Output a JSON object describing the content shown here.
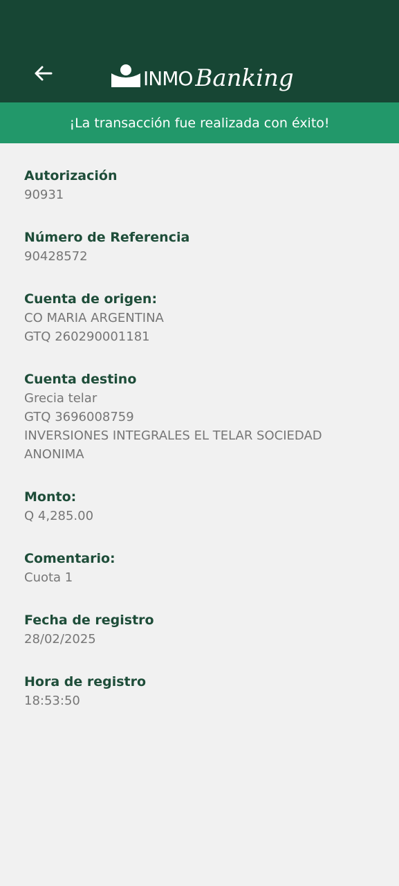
{
  "header": {
    "back_icon": "arrow-left-icon",
    "logo_icon": "inmo-logo-mark-icon",
    "logo_part1": "INMO",
    "logo_part2": "Banking"
  },
  "banner": {
    "message": "¡La transacción fue realizada con éxito!"
  },
  "colors": {
    "header_bg": "#174634",
    "banner_bg": "#22986a",
    "label_color": "#1e4d39",
    "value_color": "#767676",
    "page_bg": "#f1f1f1"
  },
  "fields": {
    "autorizacion": {
      "label": "Autorización",
      "value": "90931"
    },
    "referencia": {
      "label": "Número de Referencia",
      "value": "90428572"
    },
    "origen": {
      "label": "Cuenta de origen:",
      "line1": "CO MARIA ARGENTINA",
      "line2": "GTQ 260290001181"
    },
    "destino": {
      "label": "Cuenta destino",
      "line1": "Grecia telar",
      "line2": "GTQ 3696008759",
      "line3": "INVERSIONES INTEGRALES EL TELAR  SOCIEDAD ANONIMA"
    },
    "monto": {
      "label": "Monto:",
      "value": "Q 4,285.00"
    },
    "comentario": {
      "label": "Comentario:",
      "value": "Cuota 1"
    },
    "fecha": {
      "label": "Fecha de registro",
      "value": "28/02/2025"
    },
    "hora": {
      "label": "Hora de registro",
      "value": "18:53:50"
    }
  }
}
